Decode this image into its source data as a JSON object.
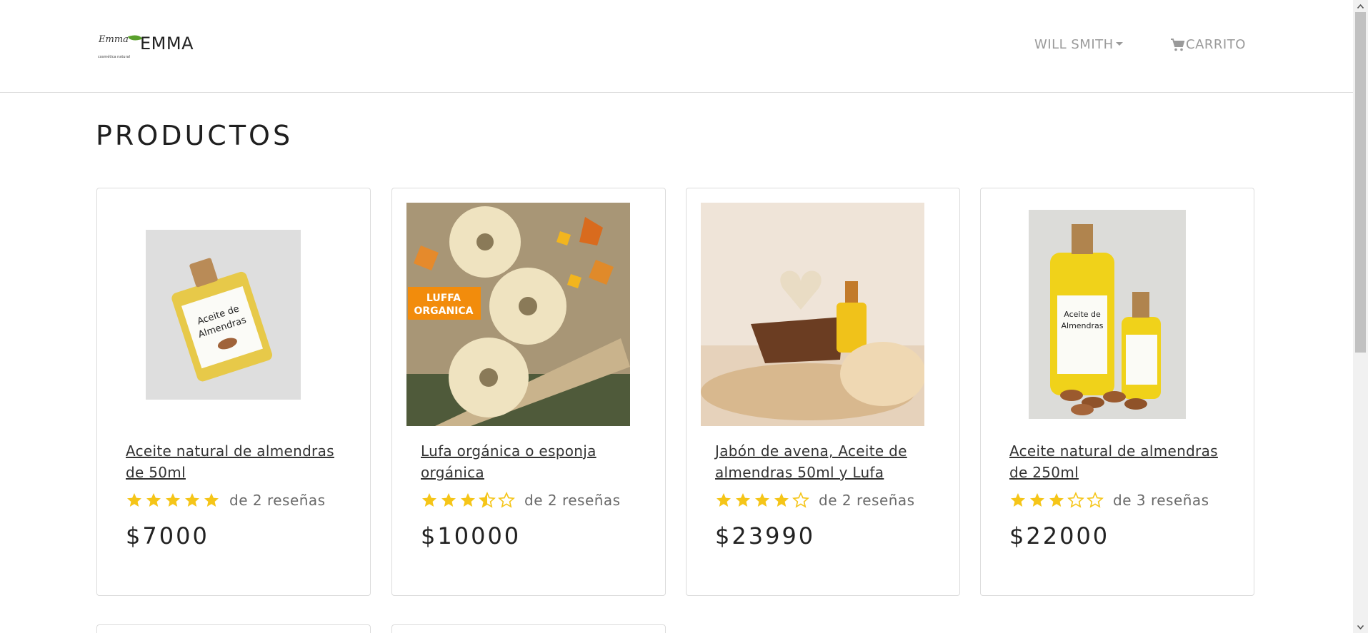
{
  "brand": {
    "logo_script": "Emma",
    "logo_tagline": "cosmética natural",
    "name": "EMMA"
  },
  "nav": {
    "user_label": "WILL SMITH",
    "cart_label": "CARRITO"
  },
  "page": {
    "title": "PRODUCTOS"
  },
  "products": [
    {
      "title": "Aceite natural de almendras de 50ml",
      "rating": 5,
      "reviews": "de 2 reseñas",
      "price": "$7000",
      "image_label_1": "Aceite de",
      "image_label_2": "Almendras"
    },
    {
      "title": "Lufa orgánica o esponja orgánica",
      "rating": 3.5,
      "reviews": "de 2 reseñas",
      "price": "$10000",
      "badge_1": "LUFFA",
      "badge_2": "ORGANICA"
    },
    {
      "title": "Jabón de avena, Aceite de almendras 50ml y Lufa",
      "rating": 4,
      "reviews": "de 2 reseñas",
      "price": "$23990"
    },
    {
      "title": "Aceite natural de almendras de 250ml",
      "rating": 3,
      "reviews": "de 3 reseñas",
      "price": "$22000",
      "image_label_1": "Aceite de",
      "image_label_2": "Almendras"
    }
  ],
  "colors": {
    "star": "#f5c518",
    "nav_text": "#9a9a9a",
    "border": "#dcdcdc"
  }
}
